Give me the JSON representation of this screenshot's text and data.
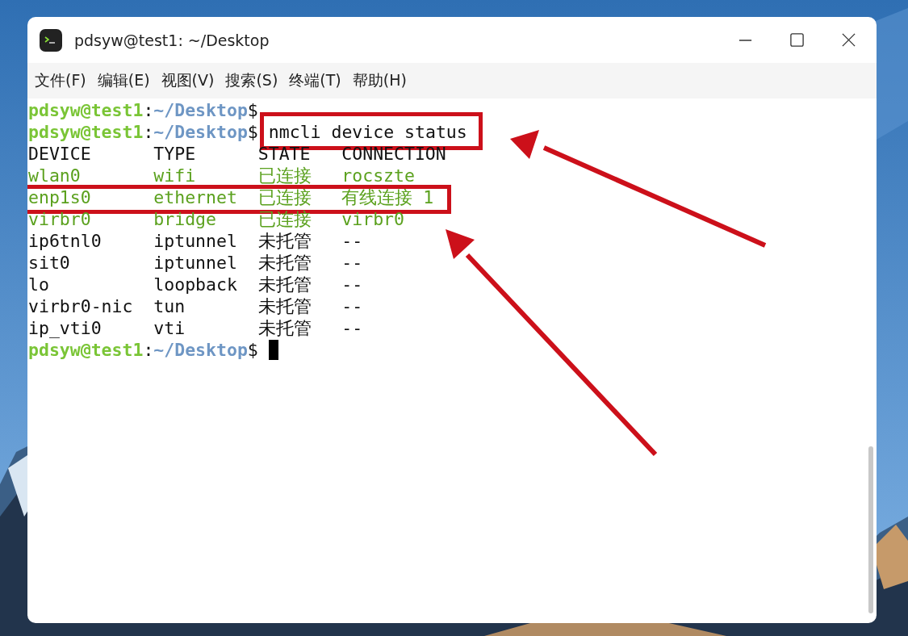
{
  "window": {
    "title": "pdsyw@test1: ~/Desktop"
  },
  "menu": [
    {
      "label": "文件(F)"
    },
    {
      "label": "编辑(E)"
    },
    {
      "label": "视图(V)"
    },
    {
      "label": "搜索(S)"
    },
    {
      "label": "终端(T)"
    },
    {
      "label": "帮助(H)"
    }
  ],
  "terminal": {
    "lines": [
      {
        "kind": "prompt",
        "user": "pdsyw@test1",
        "separator": ":",
        "path": "~/Desktop",
        "symbol": "$"
      },
      {
        "kind": "prompt",
        "user": "pdsyw@test1",
        "separator": ":",
        "path": "~/Desktop",
        "symbol": "$",
        "command": "nmcli device status",
        "highlighted": true
      },
      {
        "kind": "header",
        "cells": [
          "DEVICE",
          "TYPE",
          "STATE",
          "CONNECTION"
        ]
      },
      {
        "kind": "row",
        "cells": [
          "wlan0",
          "wifi",
          "已连接",
          "rocszte"
        ],
        "connected": true,
        "highlighted": false
      },
      {
        "kind": "row",
        "cells": [
          "enp1s0",
          "ethernet",
          "已连接",
          "有线连接 1"
        ],
        "connected": true,
        "highlighted": true
      },
      {
        "kind": "row",
        "cells": [
          "virbr0",
          "bridge",
          "已连接",
          "virbr0"
        ],
        "connected": true,
        "highlighted": false
      },
      {
        "kind": "row",
        "cells": [
          "ip6tnl0",
          "iptunnel",
          "未托管",
          "--"
        ],
        "connected": false,
        "highlighted": false
      },
      {
        "kind": "row",
        "cells": [
          "sit0",
          "iptunnel",
          "未托管",
          "--"
        ],
        "connected": false,
        "highlighted": false
      },
      {
        "kind": "row",
        "cells": [
          "lo",
          "loopback",
          "未托管",
          "--"
        ],
        "connected": false,
        "highlighted": false
      },
      {
        "kind": "row",
        "cells": [
          "virbr0-nic",
          "tun",
          "未托管",
          "--"
        ],
        "connected": false,
        "highlighted": false
      },
      {
        "kind": "row",
        "cells": [
          "ip_vti0",
          "vti",
          "未托管",
          "--"
        ],
        "connected": false,
        "highlighted": false
      },
      {
        "kind": "prompt",
        "user": "pdsyw@test1",
        "separator": ":",
        "path": "~/Desktop",
        "symbol": "$",
        "cursor": true
      }
    ]
  }
}
